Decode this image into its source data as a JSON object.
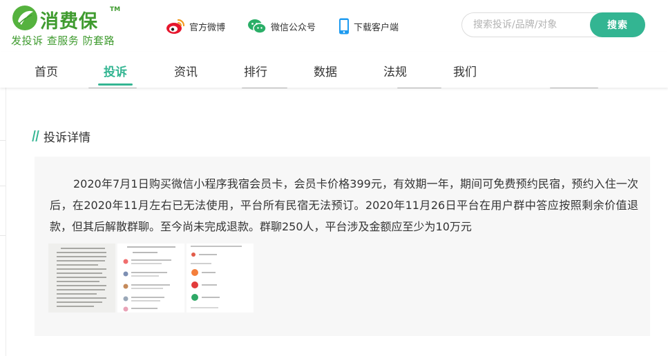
{
  "brand": {
    "name": "消费保",
    "tm": "TM",
    "slogan": "发投诉 查服务 防套路",
    "logo_icon": "leaf-logo-icon",
    "color": "#3f9b2f"
  },
  "header": {
    "links": [
      {
        "label": "官方微博",
        "icon": "weibo-icon"
      },
      {
        "label": "微信公众号",
        "icon": "wechat-icon"
      },
      {
        "label": "下载客户端",
        "icon": "phone-icon"
      }
    ],
    "search": {
      "placeholder": "搜索投诉/品牌/对象",
      "value": "",
      "button_label": "搜索"
    }
  },
  "nav": {
    "items": [
      {
        "label": "首页",
        "active": false
      },
      {
        "label": "投诉",
        "active": true
      },
      {
        "label": "资讯",
        "active": false
      },
      {
        "label": "排行",
        "active": false
      },
      {
        "label": "数据",
        "active": false
      },
      {
        "label": "法规",
        "active": false
      },
      {
        "label": "我们",
        "active": false
      }
    ]
  },
  "complaint": {
    "section_title": "投诉详情",
    "text": "2020年7月1日购买微信小程序我宿会员卡，会员卡价格399元，有效期一年，期间可免费预约民宿，预约入住一次后，在2020年11月左右已无法使用，平台所有民宿无法预订。2020年11月26日平台在用户群中答应按照剩余价值退款，但其后解散群聊。至今尚未完成退款。群聊250人，平台涉及金额应至少为10万元",
    "attachment_icons": [
      "screenshot-image",
      "screenshot-image",
      "screenshot-image"
    ]
  },
  "colors": {
    "accent": "#33b592",
    "card_bg": "#f7f7f7",
    "text": "#333333"
  }
}
